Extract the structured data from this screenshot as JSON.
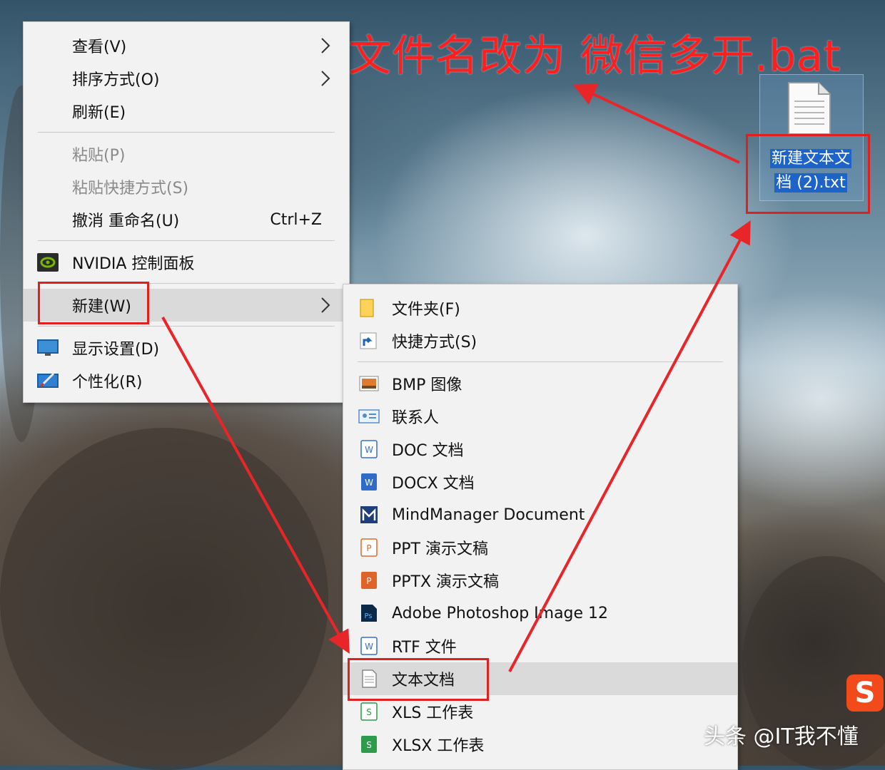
{
  "annotation": "文件名改为 微信多开.bat",
  "desktop_file": {
    "name": "新建文本文档 (2).txt",
    "line1": "新建文本文",
    "line2": "档 (2).txt"
  },
  "main_menu": {
    "view": "查看(V)",
    "sort": "排序方式(O)",
    "refresh": "刷新(E)",
    "paste": "粘贴(P)",
    "paste_shortcut": "粘贴快捷方式(S)",
    "undo": "撤消 重命名(U)",
    "undo_shortcut": "Ctrl+Z",
    "nvidia": "NVIDIA 控制面板",
    "new": "新建(W)",
    "display": "显示设置(D)",
    "personalize": "个性化(R)"
  },
  "sub_menu": {
    "folder": "文件夹(F)",
    "shortcut": "快捷方式(S)",
    "bmp": "BMP 图像",
    "contact": "联系人",
    "doc": "DOC 文档",
    "docx": "DOCX 文档",
    "mindmanager": "MindManager Document",
    "ppt": "PPT 演示文稿",
    "pptx": "PPTX 演示文稿",
    "psd": "Adobe Photoshop Image 12",
    "rtf": "RTF 文件",
    "txt": "文本文档",
    "xls": "XLS 工作表",
    "xlsx": "XLSX 工作表"
  },
  "watermark": "头条 @IT我不懂",
  "logo_letter": "S",
  "colors": {
    "annotation_red": "#ff1e1e",
    "selection_blue": "#1e63c8"
  }
}
